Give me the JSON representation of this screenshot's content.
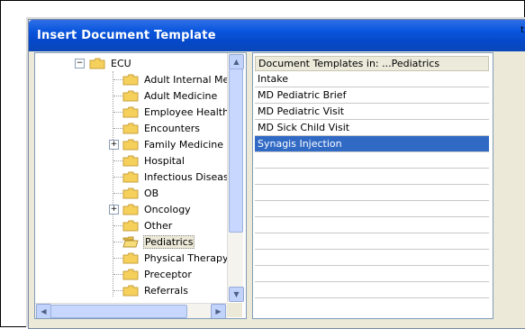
{
  "dialog": {
    "title": "Insert Document Template",
    "title_clip": "t"
  },
  "tree": {
    "root": "ECU",
    "items": [
      {
        "label": "Adult Internal Medic",
        "expandable": false
      },
      {
        "label": "Adult Medicine",
        "expandable": false
      },
      {
        "label": "Employee Health",
        "expandable": false
      },
      {
        "label": "Encounters",
        "expandable": false
      },
      {
        "label": "Family Medicine",
        "expandable": true
      },
      {
        "label": "Hospital",
        "expandable": false
      },
      {
        "label": "Infectious Disease",
        "expandable": false
      },
      {
        "label": "OB",
        "expandable": false
      },
      {
        "label": "Oncology",
        "expandable": true
      },
      {
        "label": "Other",
        "expandable": false
      },
      {
        "label": "Pediatrics",
        "expandable": false,
        "selected": true
      },
      {
        "label": "Physical Therapy",
        "expandable": false
      },
      {
        "label": "Preceptor",
        "expandable": false
      },
      {
        "label": "Referrals",
        "expandable": false
      }
    ],
    "scroll_arrow_up": "▲",
    "scroll_arrow_down": "▼",
    "scroll_arrow_left": "◀",
    "scroll_arrow_right": "▶"
  },
  "list": {
    "header": "Document Templates in: ...Pediatrics",
    "rows": [
      "Intake",
      "MD Pediatric Brief",
      "MD Pediatric Visit",
      "MD Sick Child Visit",
      "Synagis Injection",
      "",
      "",
      "",
      "",
      "",
      "",
      "",
      "",
      ""
    ],
    "selected_index": 4
  },
  "colors": {
    "title_bar": "#0a56de",
    "selection": "#316ac5",
    "folder": "#f5d05b"
  }
}
